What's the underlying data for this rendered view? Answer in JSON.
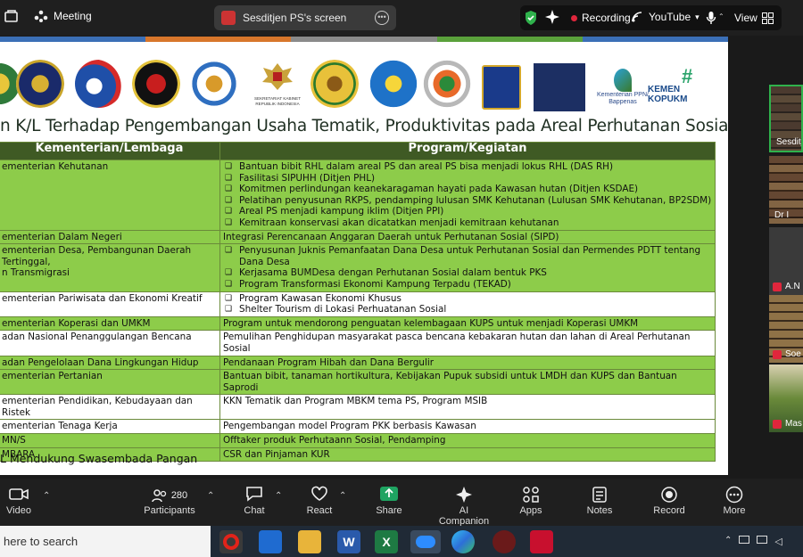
{
  "topbar": {
    "meeting_label": "Meeting",
    "screen_share_label": "Sesditjen PS's screen",
    "recording_label": "Recording",
    "youtube_label": "YouTube",
    "view_label": "View"
  },
  "slide": {
    "title": "n K/L Terhadap Pengembangan Usaha Tematik, Produktivitas pada Areal Perhutanan Sosial",
    "logo_texts": {
      "setkab": "SEKRETARIAT KABINET\nREPUBLIK INDONESIA",
      "bappenas": "Kementerian PPN/\nBappenas",
      "kemenkop": "KEMEN\nKOPUKM"
    },
    "table": {
      "headers": [
        "Kementerian/Lembaga",
        "Program/Kegiatan"
      ],
      "rows": [
        {
          "ministry": "ementerian Kehutanan",
          "style": "g",
          "items": [
            "Bantuan bibit RHL dalam areal PS dan areal PS bisa menjadi lokus RHL (DAS RH)",
            "Fasilitasi SIPUHH (Ditjen PHL)",
            "Komitmen perlindungan keanekaragaman hayati pada Kawasan hutan (Ditjen KSDAE)",
            "Pelatihan penyusunan RKPS, pendamping lulusan SMK Kehutanan (Lulusan SMK Kehutanan, BP2SDM)",
            "Areal PS menjadi kampung iklim (Ditjen PPI)",
            "Kemitraan konservasi akan dicatatkan menjadi kemitraan kehutanan"
          ]
        },
        {
          "ministry": "ementerian Dalam Negeri",
          "style": "g",
          "text": "Integrasi Perencanaan Anggaran Daerah untuk Perhutanan Sosial (SIPD)"
        },
        {
          "ministry": "ementerian Desa, Pembangunan Daerah Tertinggal,\nn Transmigrasi",
          "style": "g",
          "items": [
            "Penyusunan Juknis Pemanfaatan Dana Desa untuk Perhutanan Sosial dan Permendes PDTT tentang Dana Desa",
            "Kerjasama BUMDesa dengan Perhutanan Sosial dalam bentuk PKS",
            "Program Transformasi Ekonomi Kampung Terpadu (TEKAD)"
          ]
        },
        {
          "ministry": "ementerian Pariwisata dan Ekonomi Kreatif",
          "style": "w",
          "items": [
            "Program Kawasan Ekonomi Khusus",
            "Shelter Tourism di Lokasi Perhuatanan Sosial"
          ]
        },
        {
          "ministry": "ementerian Koperasi dan UMKM",
          "style": "g",
          "text": "Program untuk mendorong penguatan kelembagaan KUPS untuk menjadi Koperasi UMKM"
        },
        {
          "ministry": "adan Nasional Penanggulangan Bencana",
          "style": "w",
          "text": "Pemulihan Penghidupan masyarakat pasca bencana kebakaran hutan dan lahan di Areal Perhutanan Sosial"
        },
        {
          "ministry": "adan Pengelolaan Dana Lingkungan Hidup",
          "style": "g",
          "text": "Pendanaan Program Hibah dan Dana Bergulir"
        },
        {
          "ministry": "ementerian Pertanian",
          "style": "g",
          "text": "Bantuan bibit, tanaman hortikultura, Kebijakan Pupuk subsidi untuk LMDH dan KUPS dan Bantuan Saprodi"
        },
        {
          "ministry": "ementerian Pendidikan, Kebudayaan dan Ristek",
          "style": "w",
          "text": "KKN Tematik dan Program MBKM tema PS, Program MSIB"
        },
        {
          "ministry": "ementerian Tenaga Kerja",
          "style": "w",
          "text": "Pengembangan model Program PKK berbasis Kawasan"
        },
        {
          "ministry": "MN/S",
          "style": "g",
          "text": "Offtaker produk Perhutaann Sosial, Pendamping"
        },
        {
          "ministry": "MBARA",
          "style": "g",
          "text": "CSR dan Pinjaman KUR"
        }
      ]
    },
    "footnote": "L Mendukung Swasembada Pangan"
  },
  "participants_panel": {
    "tiles": [
      "Sesditjen",
      "Dr I",
      "A.N",
      "Soe",
      "Mas"
    ]
  },
  "toolbar": {
    "video": "Video",
    "participants": "Participants",
    "participants_count": "280",
    "chat": "Chat",
    "react": "React",
    "share": "Share",
    "ai_companion": "AI Companion",
    "apps": "Apps",
    "notes": "Notes",
    "record": "Record",
    "more": "More"
  },
  "taskbar": {
    "search_placeholder": "here to search"
  },
  "colors": {
    "header_green": "#3f5a24",
    "row_green": "#8dcc4a",
    "share_green": "#1fa462",
    "record_red": "#e0263c"
  }
}
